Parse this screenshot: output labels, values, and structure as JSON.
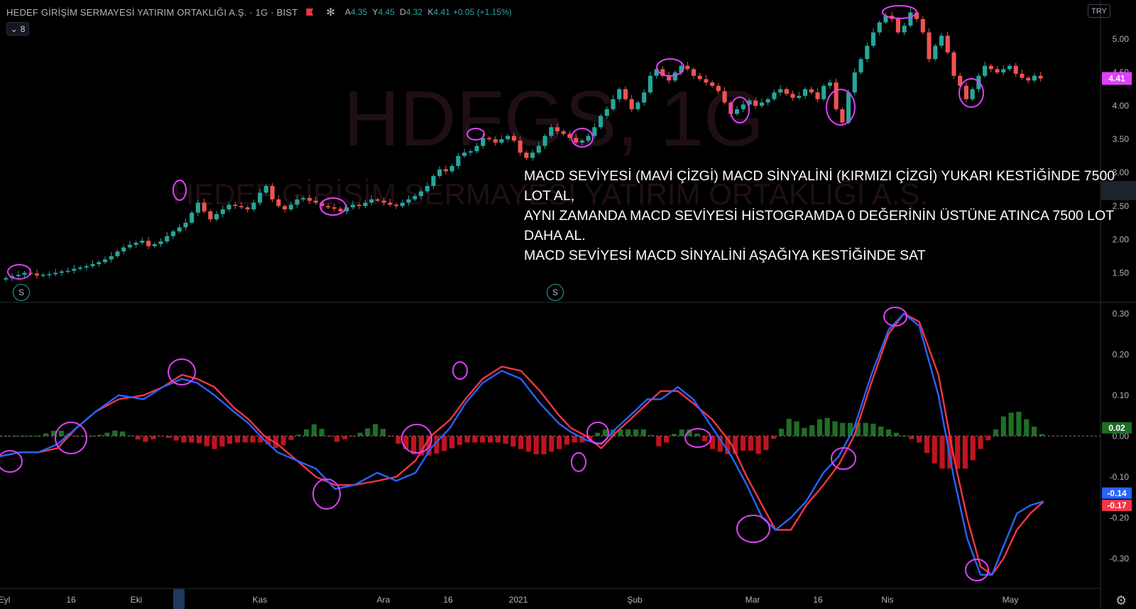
{
  "header": {
    "symbol_title": "HEDEF GİRİŞİM SERMAYESİ YATIRIM ORTAKLIĞI A.Ş. · 1G · BIST",
    "o_label": "A",
    "o_value": "4.35",
    "h_label": "Y",
    "h_value": "4.45",
    "l_label": "D",
    "l_value": "4.32",
    "c_label": "K",
    "c_value": "4.41",
    "change": "+0.05 (+1.15%)",
    "collapse_count": "8",
    "currency": "TRY"
  },
  "watermark": {
    "ticker": "HDFGS, 1G",
    "name": "HEDEF GİRİŞİM SERMAYESİ YATIRIM ORTAKLIĞI A.Ş."
  },
  "annotation": {
    "line1": "MACD SEVİYESİ (MAVİ ÇİZGİ) MACD SİNYALİNİ (KIRMIZI ÇİZGİ) YUKARI KESTİĞİNDE 7500 LOT AL,",
    "line2": "AYNI ZAMANDA MACD SEVİYESİ HİSTOGRAMDA 0 DEĞERİNİN ÜSTÜNE ATINCA 7500 LOT DAHA AL.",
    "line3": "MACD SEVİYESİ MACD SİNYALİNİ AŞAĞIYA KESTİĞİNDE SAT"
  },
  "badges": [
    "S",
    "S"
  ],
  "colors": {
    "up": "#26a69a",
    "down": "#ef5350",
    "macd": "#2962ff",
    "signal": "#f23645",
    "hist_pos": "#1f6e26",
    "hist_neg": "#c0141e",
    "circle": "#e040fb",
    "price_tag": "#e040fb"
  },
  "chart_data": [
    {
      "type": "candlestick",
      "title": "HEDEF GİRİŞİM SERMAYESİ YATIRIM ORTAKLIĞI A.Ş. · 1G · BIST",
      "ylim": [
        1.1,
        5.5
      ],
      "y_ticks": [
        "5.00",
        "4.50",
        "4.00",
        "3.50",
        "3.00",
        "2.50",
        "2.00",
        "1.50"
      ],
      "last_price": "4.41",
      "closes": [
        1.42,
        1.45,
        1.47,
        1.5,
        1.49,
        1.46,
        1.47,
        1.48,
        1.5,
        1.52,
        1.53,
        1.56,
        1.58,
        1.6,
        1.63,
        1.66,
        1.7,
        1.75,
        1.82,
        1.88,
        1.92,
        1.95,
        1.98,
        1.9,
        1.93,
        1.97,
        2.05,
        2.12,
        2.18,
        2.25,
        2.4,
        2.55,
        2.42,
        2.3,
        2.38,
        2.45,
        2.52,
        2.5,
        2.48,
        2.45,
        2.55,
        2.7,
        2.8,
        2.6,
        2.5,
        2.45,
        2.52,
        2.6,
        2.62,
        2.58,
        2.55,
        2.5,
        2.48,
        2.46,
        2.42,
        2.48,
        2.52,
        2.5,
        2.55,
        2.6,
        2.58,
        2.55,
        2.52,
        2.5,
        2.55,
        2.6,
        2.65,
        2.72,
        2.8,
        2.95,
        3.05,
        3.02,
        3.1,
        3.25,
        3.3,
        3.32,
        3.4,
        3.52,
        3.5,
        3.45,
        3.5,
        3.55,
        3.48,
        3.3,
        3.22,
        3.3,
        3.4,
        3.55,
        3.68,
        3.62,
        3.58,
        3.52,
        3.45,
        3.48,
        3.55,
        3.68,
        3.85,
        3.95,
        4.1,
        4.25,
        4.1,
        3.95,
        4.05,
        4.2,
        4.45,
        4.55,
        4.45,
        4.38,
        4.5,
        4.6,
        4.55,
        4.45,
        4.4,
        4.35,
        4.3,
        4.22,
        4.05,
        3.88,
        3.95,
        4.02,
        4.08,
        4.0,
        4.05,
        4.1,
        4.2,
        4.25,
        4.18,
        4.12,
        4.15,
        4.25,
        4.2,
        4.1,
        4.3,
        4.35,
        3.95,
        3.75,
        4.2,
        4.5,
        4.7,
        4.9,
        5.1,
        5.25,
        5.35,
        5.3,
        5.1,
        5.2,
        5.4,
        5.3,
        5.1,
        4.7,
        4.9,
        5.05,
        4.8,
        4.45,
        4.3,
        4.1,
        4.25,
        4.45,
        4.6,
        4.55,
        4.5,
        4.55,
        4.6,
        4.48,
        4.42,
        4.38,
        4.45,
        4.41
      ],
      "events": [
        "Eyl",
        "16",
        "Eki",
        "Kas",
        "Ara",
        "16",
        "2021",
        "Şub",
        "Mar",
        "16",
        "Nis",
        "May"
      ]
    },
    {
      "type": "macd",
      "ylim": [
        -0.37,
        0.31
      ],
      "y_ticks": [
        "0.30",
        "0.20",
        "0.10",
        "0.00",
        "-0.10",
        "-0.20",
        "-0.30"
      ],
      "macd_last": "-0.14",
      "signal_last": "-0.17",
      "hist_last": "0.02",
      "x_ticks": [
        "Eyl",
        "16",
        "Eki",
        "Kas",
        "Ara",
        "16",
        "2021",
        "Şub",
        "Mar",
        "16",
        "Nis",
        "May"
      ],
      "macd": [
        [
          0,
          -0.05
        ],
        [
          10,
          -0.04
        ],
        [
          20,
          -0.04
        ],
        [
          30,
          -0.02
        ],
        [
          40,
          0.02
        ],
        [
          50,
          0.06
        ],
        [
          62,
          0.1
        ],
        [
          75,
          0.09
        ],
        [
          85,
          0.12
        ],
        [
          95,
          0.14
        ],
        [
          103,
          0.13
        ],
        [
          112,
          0.1
        ],
        [
          122,
          0.06
        ],
        [
          130,
          0.03
        ],
        [
          138,
          -0.01
        ],
        [
          145,
          -0.04
        ],
        [
          155,
          -0.06
        ],
        [
          165,
          -0.08
        ],
        [
          175,
          -0.13
        ],
        [
          185,
          -0.12
        ],
        [
          197,
          -0.09
        ],
        [
          207,
          -0.11
        ],
        [
          217,
          -0.09
        ],
        [
          225,
          -0.03
        ],
        [
          235,
          0.02
        ],
        [
          243,
          0.08
        ],
        [
          252,
          0.13
        ],
        [
          262,
          0.16
        ],
        [
          272,
          0.14
        ],
        [
          282,
          0.08
        ],
        [
          292,
          0.03
        ],
        [
          298,
          0.01
        ],
        [
          306,
          -0.01
        ],
        [
          314,
          -0.02
        ],
        [
          322,
          0.02
        ],
        [
          329,
          0.05
        ],
        [
          338,
          0.09
        ],
        [
          345,
          0.09
        ],
        [
          354,
          0.12
        ],
        [
          362,
          0.09
        ],
        [
          372,
          0.02
        ],
        [
          382,
          -0.05
        ],
        [
          390,
          -0.12
        ],
        [
          398,
          -0.2
        ],
        [
          405,
          -0.23
        ],
        [
          413,
          -0.2
        ],
        [
          421,
          -0.16
        ],
        [
          430,
          -0.09
        ],
        [
          438,
          -0.05
        ],
        [
          446,
          0.02
        ],
        [
          455,
          0.15
        ],
        [
          464,
          0.26
        ],
        [
          472,
          0.3
        ],
        [
          480,
          0.27
        ],
        [
          490,
          0.1
        ],
        [
          498,
          -0.1
        ],
        [
          505,
          -0.25
        ],
        [
          512,
          -0.34
        ],
        [
          518,
          -0.34
        ],
        [
          524,
          -0.27
        ],
        [
          531,
          -0.19
        ],
        [
          538,
          -0.17
        ],
        [
          545,
          -0.16
        ]
      ],
      "signal": [
        [
          0,
          -0.05
        ],
        [
          10,
          -0.04
        ],
        [
          20,
          -0.04
        ],
        [
          30,
          -0.03
        ],
        [
          40,
          0.02
        ],
        [
          50,
          0.06
        ],
        [
          62,
          0.09
        ],
        [
          75,
          0.1
        ],
        [
          85,
          0.12
        ],
        [
          95,
          0.15
        ],
        [
          103,
          0.14
        ],
        [
          112,
          0.12
        ],
        [
          122,
          0.07
        ],
        [
          130,
          0.04
        ],
        [
          138,
          0.0
        ],
        [
          145,
          -0.02
        ],
        [
          155,
          -0.06
        ],
        [
          165,
          -0.1
        ],
        [
          175,
          -0.12
        ],
        [
          185,
          -0.12
        ],
        [
          197,
          -0.11
        ],
        [
          207,
          -0.1
        ],
        [
          217,
          -0.06
        ],
        [
          225,
          0.0
        ],
        [
          235,
          0.04
        ],
        [
          243,
          0.09
        ],
        [
          252,
          0.14
        ],
        [
          262,
          0.17
        ],
        [
          272,
          0.16
        ],
        [
          282,
          0.11
        ],
        [
          292,
          0.05
        ],
        [
          298,
          0.02
        ],
        [
          306,
          0.0
        ],
        [
          314,
          -0.03
        ],
        [
          322,
          0.01
        ],
        [
          329,
          0.04
        ],
        [
          338,
          0.08
        ],
        [
          345,
          0.11
        ],
        [
          354,
          0.11
        ],
        [
          362,
          0.08
        ],
        [
          372,
          0.04
        ],
        [
          382,
          -0.02
        ],
        [
          390,
          -0.1
        ],
        [
          398,
          -0.17
        ],
        [
          405,
          -0.23
        ],
        [
          413,
          -0.23
        ],
        [
          421,
          -0.17
        ],
        [
          430,
          -0.12
        ],
        [
          438,
          -0.07
        ],
        [
          446,
          0.0
        ],
        [
          455,
          0.13
        ],
        [
          464,
          0.25
        ],
        [
          472,
          0.3
        ],
        [
          480,
          0.28
        ],
        [
          490,
          0.15
        ],
        [
          498,
          -0.05
        ],
        [
          505,
          -0.2
        ],
        [
          512,
          -0.32
        ],
        [
          518,
          -0.34
        ],
        [
          524,
          -0.3
        ],
        [
          531,
          -0.23
        ],
        [
          538,
          -0.19
        ],
        [
          545,
          -0.16
        ]
      ]
    }
  ]
}
